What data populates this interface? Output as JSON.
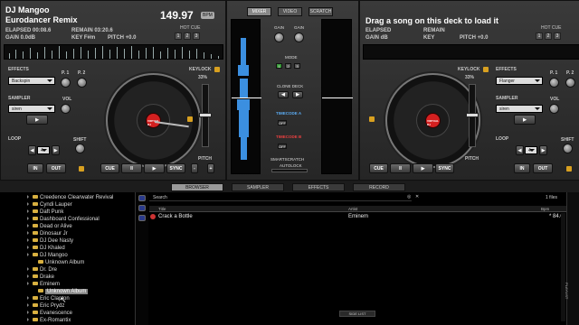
{
  "deckL": {
    "title": "DJ Mangoo",
    "subtitle": "Eurodancer Remix",
    "bpm": "149.97",
    "bpm_badge": "BPM",
    "elapsed": "ELAPSED 00:08.6",
    "remain": "REMAIN 03:20.6",
    "gain": "GAIN 0.0dB",
    "key": "KEY F#m",
    "pitch": "PITCH +0.0",
    "hotcue": "HOT CUE",
    "hc1": "1",
    "hc2": "2",
    "hc3": "3",
    "effects": "EFFECTS",
    "effect_value": "Backspin",
    "p1": "P. 1",
    "p2": "P. 2",
    "sampler": "SAMPLER",
    "sampler_value": "siren",
    "vol": "VOL",
    "loop": "LOOP",
    "shift": "SHIFT",
    "loop_value": "4",
    "in": "IN",
    "out": "OUT",
    "keylock": "KEYLOCK",
    "keylock_pct": "0%",
    "pitch_pct": "33%",
    "pitch_label": "PITCH",
    "cue": "CUE",
    "pause": "II",
    "play": "▶",
    "sync": "SYNC",
    "platter_label": "VIRTUAL DJ"
  },
  "deckR": {
    "title": "Drag a song on this deck to load it",
    "elapsed": "ELAPSED",
    "remain": "REMAIN",
    "gain": "GAIN dB",
    "key": "KEY",
    "pitch": "PITCH +0.0",
    "hotcue": "HOT CUE",
    "hc1": "1",
    "hc2": "2",
    "hc3": "3",
    "effects": "EFFECTS",
    "effect_value": "Flanger",
    "p1": "P. 1",
    "p2": "P. 2",
    "sampler": "SAMPLER",
    "sampler_value": "siren",
    "vol": "VOL",
    "loop": "LOOP",
    "shift": "SHIFT",
    "loop_value": "4",
    "in": "IN",
    "out": "OUT",
    "keylock": "KEYLOCK",
    "keylock_pct": "0%",
    "pitch_pct": "33%",
    "pitch_label": "PITCH",
    "cue": "CUE",
    "pause": "II",
    "play": "▶",
    "sync": "SYNC",
    "platter_label": "VIRTUAL DJ"
  },
  "mixer": {
    "tabs": [
      "MIXER",
      "VIDEO",
      "SCRATCH"
    ],
    "gain_l": "GAIN",
    "gain_r": "GAIN",
    "mode": "MODE",
    "mode_buttons": [
      "1",
      "2",
      "3"
    ],
    "clone_deck": "CLONE DECK",
    "timecode_a": "TIMECODE A",
    "timecode_b": "TIMECODE B",
    "off_a": "OFF",
    "off_b": "OFF",
    "smartscratch": "SMARTSCRATCH",
    "autolock": "AUTOLOCK"
  },
  "browser_tabs": [
    "BROWSER",
    "SAMPLER",
    "EFFECTS",
    "RECORD"
  ],
  "tree": [
    "Creedence Clearwater Revival",
    "Cyndi Lauper",
    "Daft Punk",
    "Dashboard Confessional",
    "Dead or Alive",
    "Dinosaur Jr",
    "DJ Dee Nasty",
    "DJ Khaled",
    "DJ Mangoo",
    "Unknown Album",
    "Dr. Dre",
    "Drake",
    "Eminem",
    "Unknown Album",
    "Eric Clapton",
    "Eric Prydz",
    "Evanescence",
    "Ex-Romantix"
  ],
  "search": {
    "label": "Search",
    "files": "1 files"
  },
  "columns": {
    "title": "Title",
    "artist": "Artist",
    "bpm": "Bpm"
  },
  "rows": [
    {
      "title": "Crack a Bottle",
      "artist": "Eminem",
      "bpm": "* 84.0"
    }
  ],
  "side_list": "SIDE LIST",
  "playlist": "PLAYLIST",
  "colors": {
    "accent_blue": "#3b8fe0",
    "record_red": "#d42020",
    "folder": "#d8b040"
  }
}
